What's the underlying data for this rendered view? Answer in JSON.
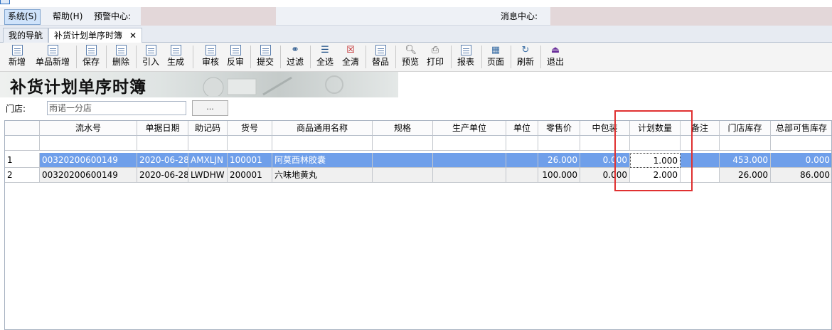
{
  "menu": {
    "system": "系统(S)",
    "help": "帮助(H)",
    "warning_center": "预警中心:",
    "message_center": "消息中心:"
  },
  "tabs": [
    {
      "label": "我的导航"
    },
    {
      "label": "补货计划单序时簿",
      "close": "✕"
    }
  ],
  "toolbar": [
    {
      "label": "新增",
      "icon": "document-icon"
    },
    {
      "label": "单品新增",
      "icon": "document-icon"
    },
    {
      "label": "保存",
      "icon": "document-icon"
    },
    {
      "label": "删除",
      "icon": "document-icon"
    },
    {
      "label": "引入",
      "icon": "document-icon"
    },
    {
      "label": "生成",
      "icon": "document-icon"
    },
    {
      "label": "审核",
      "icon": "document-icon"
    },
    {
      "label": "反审",
      "icon": "document-icon"
    },
    {
      "label": "提交",
      "icon": "document-icon"
    },
    {
      "label": "过滤",
      "icon": "binoculars-icon"
    },
    {
      "label": "全选",
      "icon": "select-all-icon"
    },
    {
      "label": "全清",
      "icon": "clear-all-icon"
    },
    {
      "label": "替品",
      "icon": "document-icon"
    },
    {
      "label": "预览",
      "icon": "preview-icon"
    },
    {
      "label": "打印",
      "icon": "printer-icon"
    },
    {
      "label": "报表",
      "icon": "document-icon"
    },
    {
      "label": "页面",
      "icon": "page-icon"
    },
    {
      "label": "刷新",
      "icon": "refresh-icon"
    },
    {
      "label": "退出",
      "icon": "exit-icon"
    }
  ],
  "banner": {
    "title": "补货计划单序时簿"
  },
  "store": {
    "label": "门店:",
    "value": "雨诺一分店",
    "button": "..."
  },
  "grid": {
    "columns": [
      "",
      "流水号",
      "单据日期",
      "助记码",
      "货号",
      "商品通用名称",
      "规格",
      "生产单位",
      "单位",
      "零售价",
      "中包装",
      "计划数量",
      "备注",
      "门店库存",
      "总部可售库存"
    ],
    "rows": [
      [
        "1",
        "00320200600149",
        "2020-06-28",
        "AMXLJN",
        "100001",
        "阿莫西林胶囊",
        "",
        "",
        "",
        "26.000",
        "0.000",
        "1.000",
        "",
        "453.000",
        "0.000"
      ],
      [
        "2",
        "00320200600149",
        "2020-06-28",
        "LWDHW",
        "200001",
        "六味地黄丸",
        "",
        "",
        "",
        "100.000",
        "0.000",
        "2.000",
        "",
        "26.000",
        "86.000"
      ]
    ]
  },
  "colors": {
    "selected_row": "#6f9fea",
    "highlight_box": "#e03131",
    "menu_active": "#cfe3fb"
  }
}
